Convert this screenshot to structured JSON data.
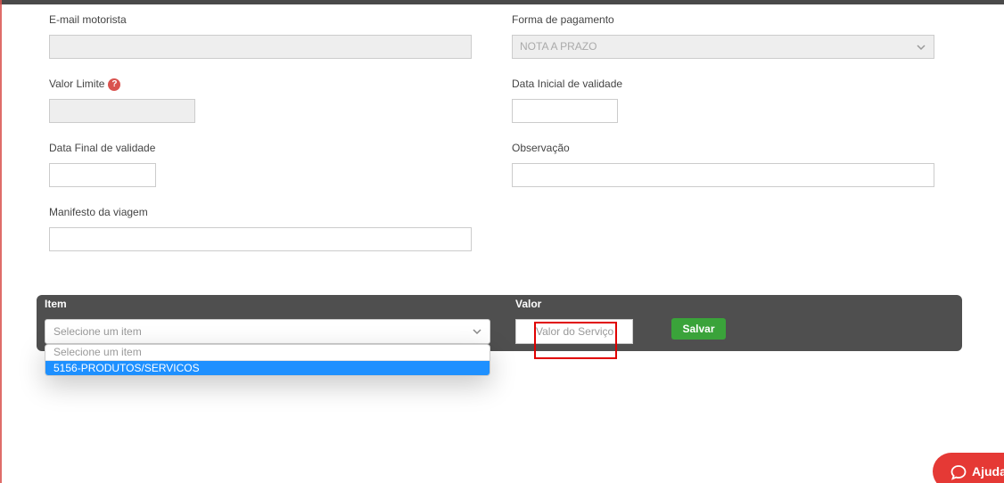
{
  "form": {
    "email_label": "E-mail motorista",
    "email_value": "",
    "payment_label": "Forma de pagamento",
    "payment_value": "NOTA A PRAZO",
    "limit_label": "Valor Limite",
    "limit_help": "?",
    "limit_value": "",
    "start_date_label": "Data Inicial de validade",
    "start_date_value": "",
    "end_date_label": "Data Final de validade",
    "end_date_value": "",
    "notes_label": "Observação",
    "notes_value": "",
    "manifest_label": "Manifesto da viagem",
    "manifest_value": ""
  },
  "item_panel": {
    "item_label": "Item",
    "item_placeholder": "Selecione um item",
    "value_label": "Valor",
    "value_placeholder": "Valor do Serviço",
    "save_label": "Salvar",
    "dropdown_options": [
      "Selecione um item",
      "5156-PRODUTOS/SERVICOS"
    ]
  },
  "help_widget": {
    "label": "Ajuda"
  },
  "icons": {
    "help": "question-circle-icon",
    "chevron": "chevron-down-icon",
    "chat": "chat-bubble-icon"
  },
  "colors": {
    "accent_green": "#3aa33a",
    "highlight_red": "#e00000",
    "selected_blue": "#1e90ff",
    "panel_dark": "#4f4f4f"
  }
}
